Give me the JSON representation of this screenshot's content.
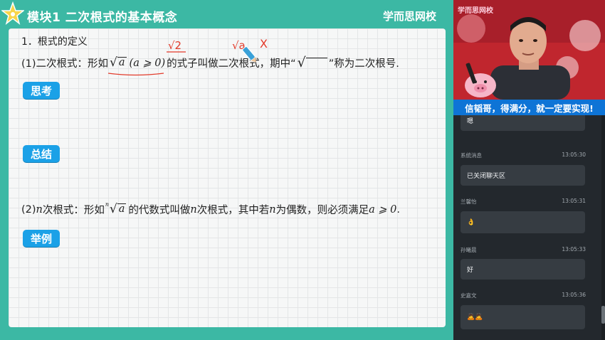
{
  "header": {
    "module_title": "模块1  二次根式的基本概念",
    "brand": "学而思网校"
  },
  "slide": {
    "section_title": "1．根式的定义",
    "line1": {
      "prefix": "(1)二次根式：形如",
      "radicand": "a",
      "condition": "(a ⩾ 0)",
      "mid": "的式子叫做二次根式，期中“",
      "suffix": "”称为二次根号."
    },
    "line2": {
      "prefix": "(2)",
      "var_n": "n",
      "t1": "次根式：形如",
      "root_index": "n",
      "radicand": "a",
      "t2": "的代数式叫做",
      "var_n2": "n",
      "t3": "次根式，其中若",
      "var_n3": "n",
      "t4": "为偶数，则必须满足",
      "cond": "a ⩾ 0",
      "end": "."
    },
    "buttons": {
      "think": "思考",
      "summary": "总结",
      "example": "举例"
    },
    "annotations": {
      "example_ok": "√2",
      "example_bad": "√a",
      "cross": "X"
    },
    "annotation_color": "#e23a2a"
  },
  "video": {
    "overlay_brand": "学而思网校",
    "motto": "信韬哥，得满分，就一定要实现!"
  },
  "chat": {
    "messages": [
      {
        "name": "",
        "time": "",
        "text": "嗯"
      },
      {
        "name": "系统消息",
        "time": "13:05:30",
        "text": "已关闭聊天区"
      },
      {
        "name": "兰馨怡",
        "time": "13:05:31",
        "text": "👌"
      },
      {
        "name": "孙曦晨",
        "time": "13:05:33",
        "text": "好"
      },
      {
        "name": "史嘉文",
        "time": "13:05:36",
        "text": "🙇🙇"
      }
    ]
  },
  "colors": {
    "header_bg": "#3cb8a4",
    "pill_bg": "#1ba1e7",
    "motto_bg": "#0e74d6",
    "chat_bg": "#23282d",
    "bubble_bg": "#363c42"
  }
}
